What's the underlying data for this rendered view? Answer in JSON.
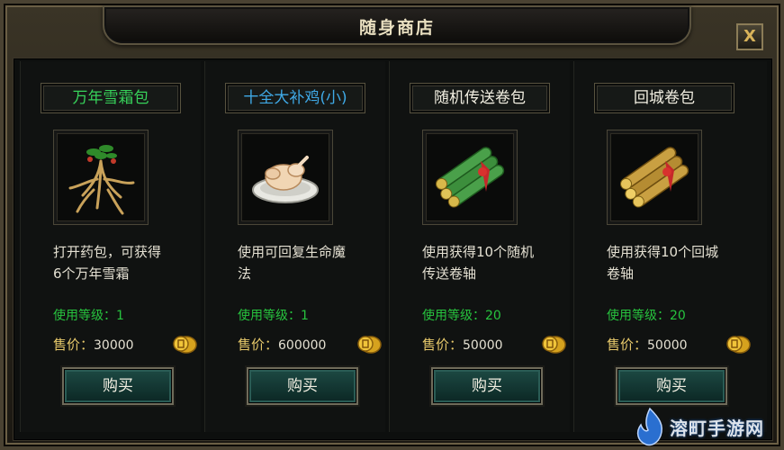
{
  "window": {
    "title": "随身商店",
    "close_label": "X"
  },
  "items": [
    {
      "name": "万年雪霜包",
      "name_color": "#37d25a",
      "icon": "ginseng-root-icon",
      "desc_line1": "打开药包，可获得",
      "desc_line2": "6个万年雪霜",
      "level_label": "使用等级：",
      "level_value": "1",
      "price_label": "售价：",
      "price_value": "30000",
      "currency_icon": "gold-coin-icon",
      "buy_label": "购买"
    },
    {
      "name": "十全大补鸡(小)",
      "name_color": "#3fa9e6",
      "icon": "roast-chicken-icon",
      "desc_line1": "使用可回复生命魔",
      "desc_line2": "法",
      "level_label": "使用等级：",
      "level_value": "1",
      "price_label": "售价：",
      "price_value": "600000",
      "currency_icon": "gold-coin-icon",
      "buy_label": "购买"
    },
    {
      "name": "随机传送卷包",
      "name_color": "#f2efe2",
      "icon": "green-scroll-bundle-icon",
      "desc_line1": "使用获得10个随机",
      "desc_line2": "传送卷轴",
      "level_label": "使用等级：",
      "level_value": "20",
      "price_label": "售价：",
      "price_value": "50000",
      "currency_icon": "gold-coin-icon",
      "buy_label": "购买"
    },
    {
      "name": "回城卷包",
      "name_color": "#f2efe2",
      "icon": "gold-scroll-bundle-icon",
      "desc_line1": "使用获得10个回城",
      "desc_line2": "卷轴",
      "level_label": "使用等级：",
      "level_value": "20",
      "price_label": "售价：",
      "price_value": "50000",
      "currency_icon": "gold-coin-icon",
      "buy_label": "购买"
    }
  ],
  "watermark": {
    "text": "溶町手游网",
    "icon": "flame-logo-icon"
  },
  "colors": {
    "level_green": "#27c33e",
    "price_gold": "#e6c86a",
    "button_teal": "#1d4a44"
  }
}
